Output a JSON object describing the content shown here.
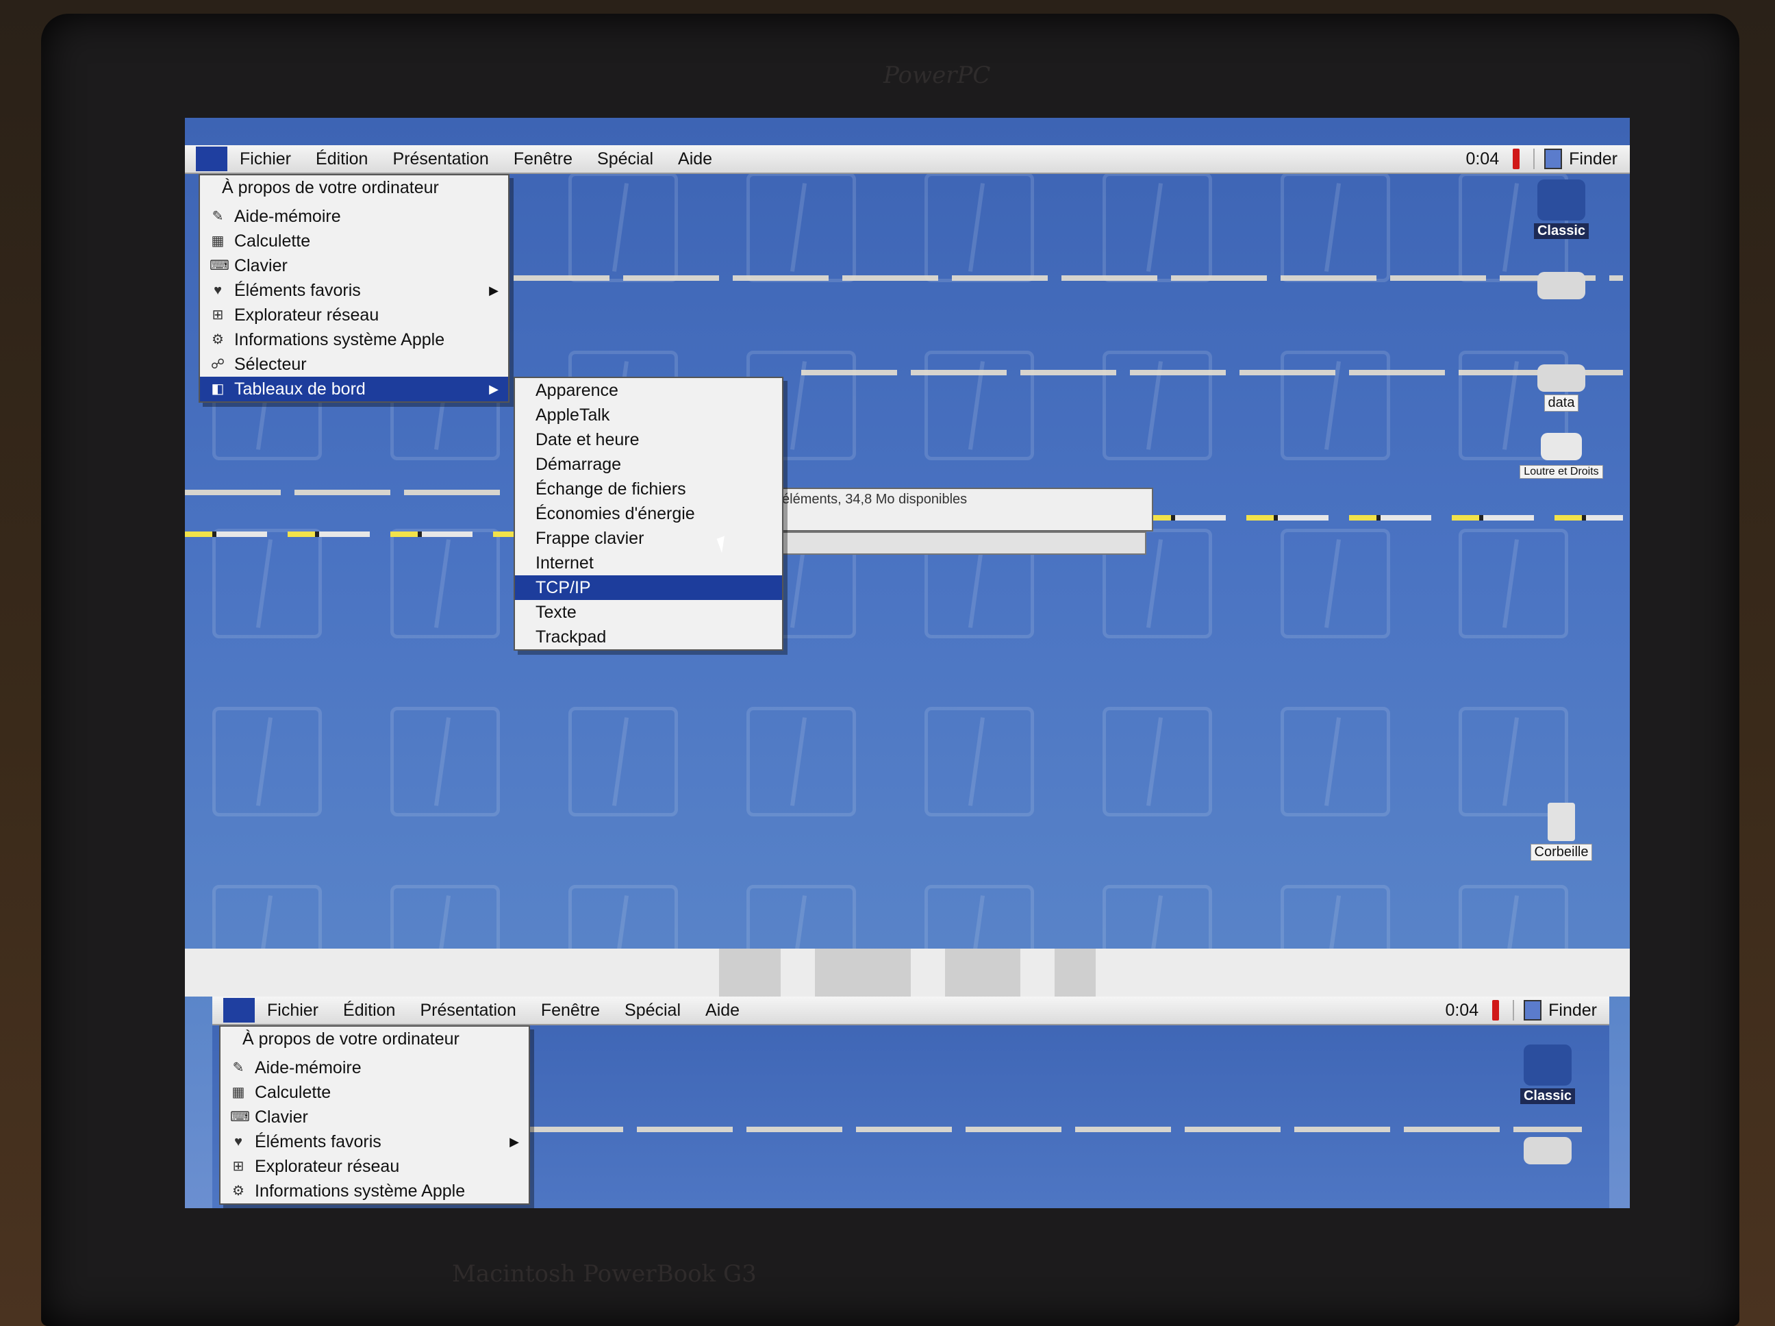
{
  "device": {
    "brand_top": "PowerPC",
    "brand_bottom": "Macintosh PowerBook G3"
  },
  "menubar": {
    "items": [
      "Fichier",
      "Édition",
      "Présentation",
      "Fenêtre",
      "Spécial",
      "Aide"
    ],
    "clock": "0:04",
    "app": "Finder"
  },
  "apple_menu": {
    "header": "À propos de votre ordinateur",
    "items": [
      {
        "label": "Aide-mémoire",
        "icon": "note-icon"
      },
      {
        "label": "Calculette",
        "icon": "calculator-icon"
      },
      {
        "label": "Clavier",
        "icon": "keyboard-icon"
      },
      {
        "label": "Éléments favoris",
        "icon": "favorites-icon",
        "submenu": true
      },
      {
        "label": "Explorateur réseau",
        "icon": "network-icon"
      },
      {
        "label": "Informations système Apple",
        "icon": "system-info-icon"
      },
      {
        "label": "Sélecteur",
        "icon": "chooser-icon"
      },
      {
        "label": "Tableaux de bord",
        "icon": "control-panels-icon",
        "submenu": true,
        "selected": true
      }
    ]
  },
  "control_panels_menu": {
    "items": [
      "Apparence",
      "AppleTalk",
      "Date et heure",
      "Démarrage",
      "Échange de fichiers",
      "Économies d'énergie",
      "Frappe clavier",
      "Internet",
      "TCP/IP",
      "Texte",
      "Trackpad"
    ],
    "selected": "TCP/IP"
  },
  "info_window": {
    "status": "éléments, 34,8 Mo disponibles"
  },
  "desktop_icons": [
    {
      "label": "Classic",
      "icon": "hard-disk-icon"
    },
    {
      "label": "",
      "icon": "disk-icon"
    },
    {
      "label": "data",
      "icon": "data-disk-icon"
    },
    {
      "label": "Loutre et Droits",
      "icon": "app-icon"
    },
    {
      "label": "Corbeille",
      "icon": "trash-icon"
    }
  ]
}
